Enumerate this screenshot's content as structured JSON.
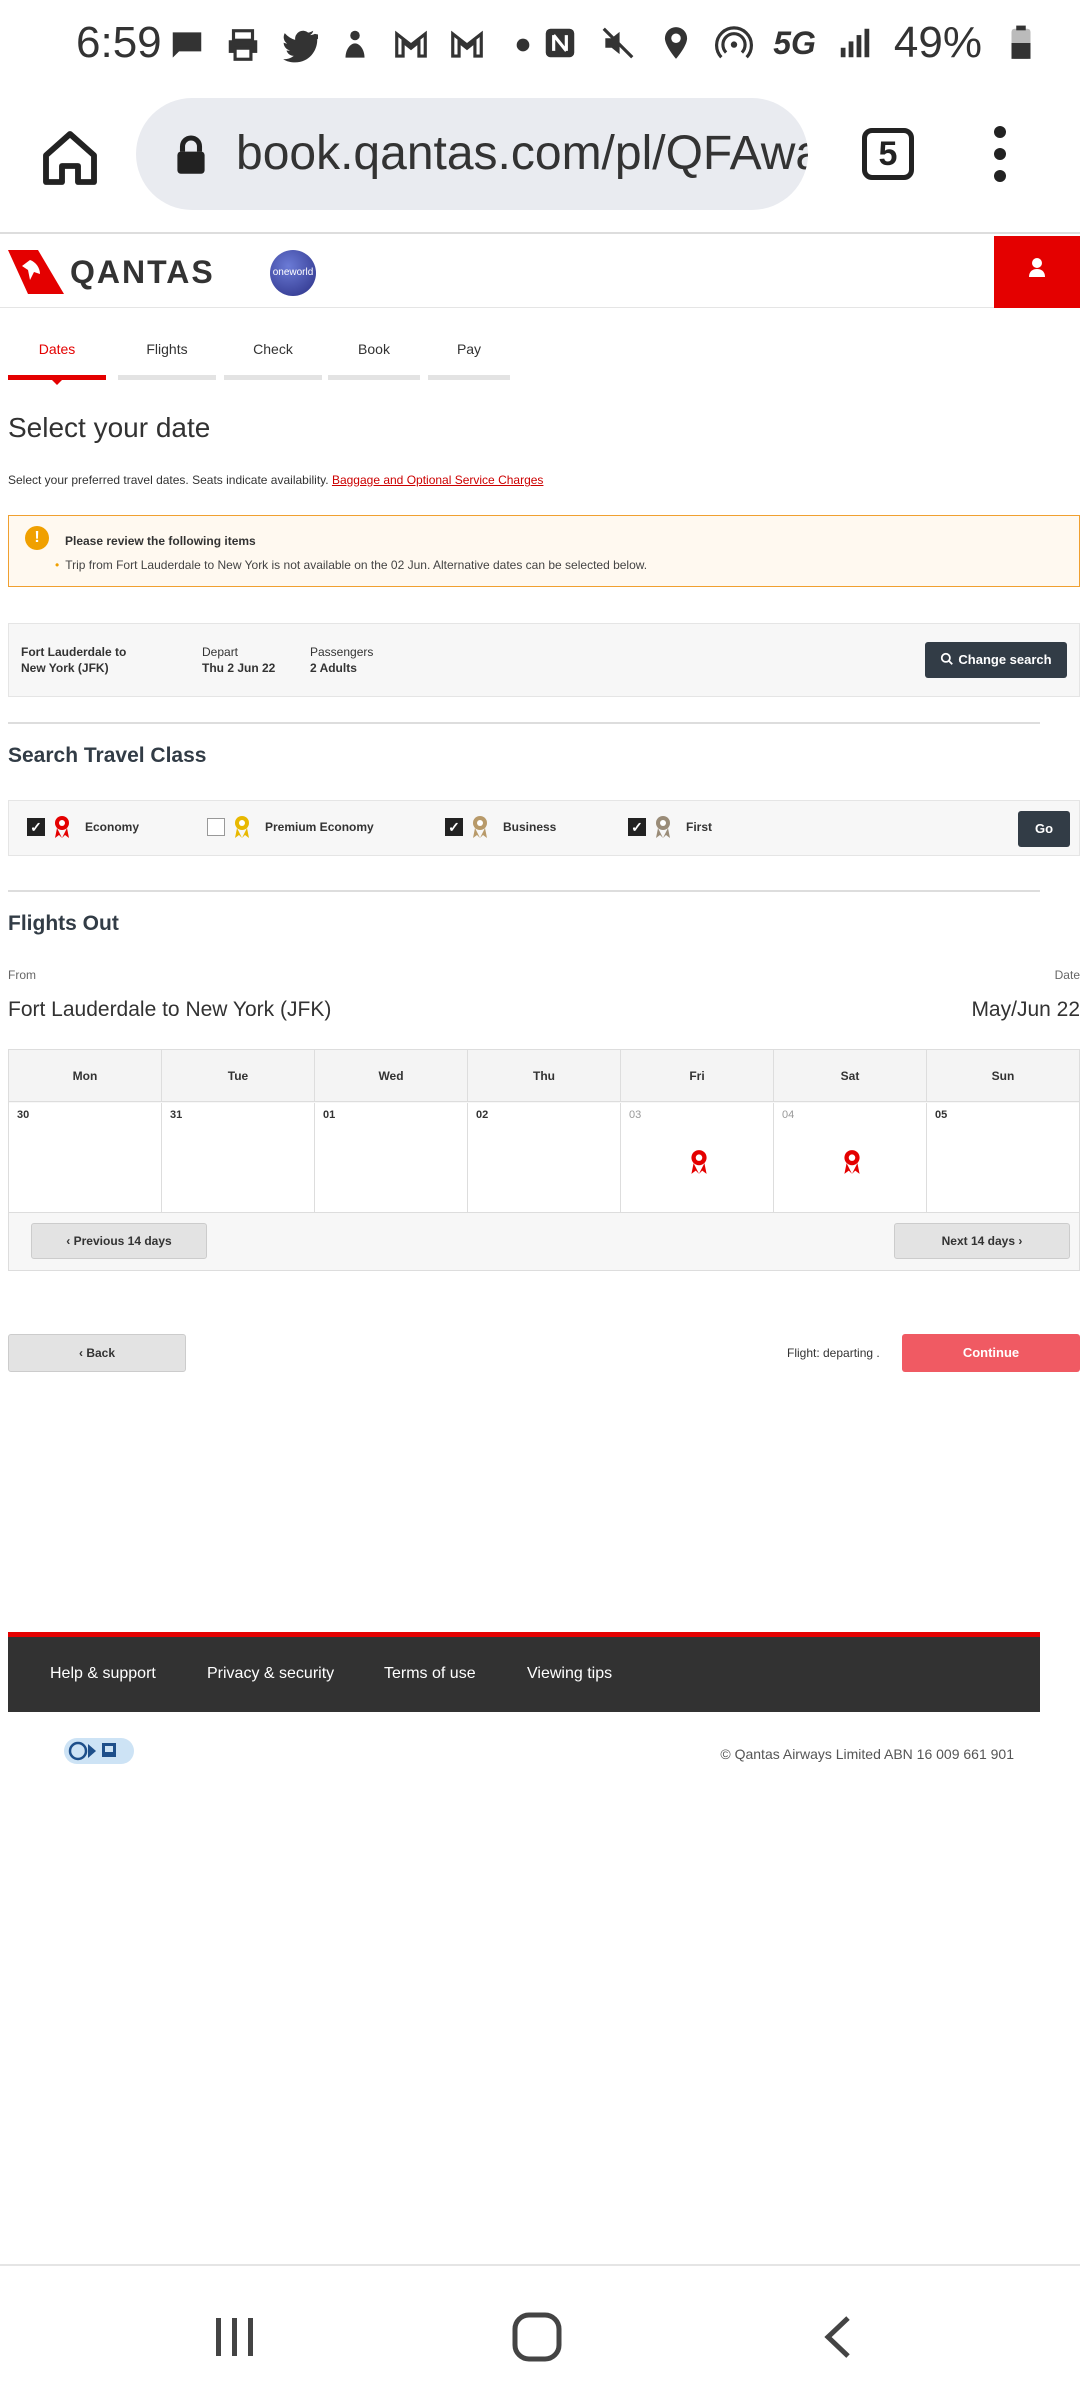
{
  "status_bar": {
    "time": "6:59",
    "battery": "49%",
    "network": "5G"
  },
  "browser": {
    "url": "book.qantas.com/pl/QFAwa",
    "tab_count": "5"
  },
  "header": {
    "brand": "QANTAS",
    "alliance": "oneworld"
  },
  "steps": [
    {
      "label": "Dates",
      "active": true
    },
    {
      "label": "Flights",
      "active": false
    },
    {
      "label": "Check",
      "active": false
    },
    {
      "label": "Book",
      "active": false
    },
    {
      "label": "Pay",
      "active": false
    }
  ],
  "page": {
    "title": "Select your date",
    "intro": "Select your preferred travel dates. Seats indicate availability.",
    "intro_link": "Baggage and Optional Service Charges"
  },
  "alert": {
    "icon": "!",
    "title": "Please review the following items",
    "item": "Trip from Fort Lauderdale to New York is not available on the 02 Jun. Alternative dates can be selected below."
  },
  "summary": {
    "route_line1": "Fort Lauderdale  to",
    "route_line2": "New York (JFK)",
    "depart_label": "Depart",
    "depart_value": "Thu 2 Jun 22",
    "passengers_label": "Passengers",
    "passengers_value": "2 Adults",
    "change_button": "Change search"
  },
  "travel_class": {
    "title": "Search Travel Class",
    "options": [
      {
        "label": "Economy",
        "checked": true,
        "medal_color": "#e40000"
      },
      {
        "label": "Premium Economy",
        "checked": false,
        "medal_color": "#e8b800"
      },
      {
        "label": "Business",
        "checked": true,
        "medal_color": "#b89a6a"
      },
      {
        "label": "First",
        "checked": true,
        "medal_color": "#9a8c78"
      }
    ],
    "go_button": "Go"
  },
  "flights_out": {
    "title": "Flights Out",
    "from_label": "From",
    "date_label": "Date",
    "route": "Fort Lauderdale to New York (JFK)",
    "date_range": "May/Jun 22"
  },
  "calendar": {
    "weekdays": [
      "Mon",
      "Tue",
      "Wed",
      "Thu",
      "Fri",
      "Sat",
      "Sun"
    ],
    "days": [
      {
        "num": "30",
        "dim": false,
        "available": false
      },
      {
        "num": "31",
        "dim": false,
        "available": false
      },
      {
        "num": "01",
        "dim": false,
        "available": false
      },
      {
        "num": "02",
        "dim": false,
        "available": false
      },
      {
        "num": "03",
        "dim": true,
        "available": true
      },
      {
        "num": "04",
        "dim": true,
        "available": true
      },
      {
        "num": "05",
        "dim": false,
        "available": false
      }
    ],
    "prev_button": "‹  Previous 14 days",
    "next_button": "Next 14 days  ›"
  },
  "actions": {
    "back_button": "‹  Back",
    "flight_status": "Flight: departing .",
    "continue_button": "Continue"
  },
  "footer": {
    "links": [
      "Help & support",
      "Privacy & security",
      "Terms of use",
      "Viewing tips"
    ],
    "copyright": "© Qantas Airways Limited ABN 16 009 661 901"
  },
  "colors": {
    "brand_red": "#e40000",
    "dark_button": "#323c46",
    "continue": "#f05a63"
  }
}
